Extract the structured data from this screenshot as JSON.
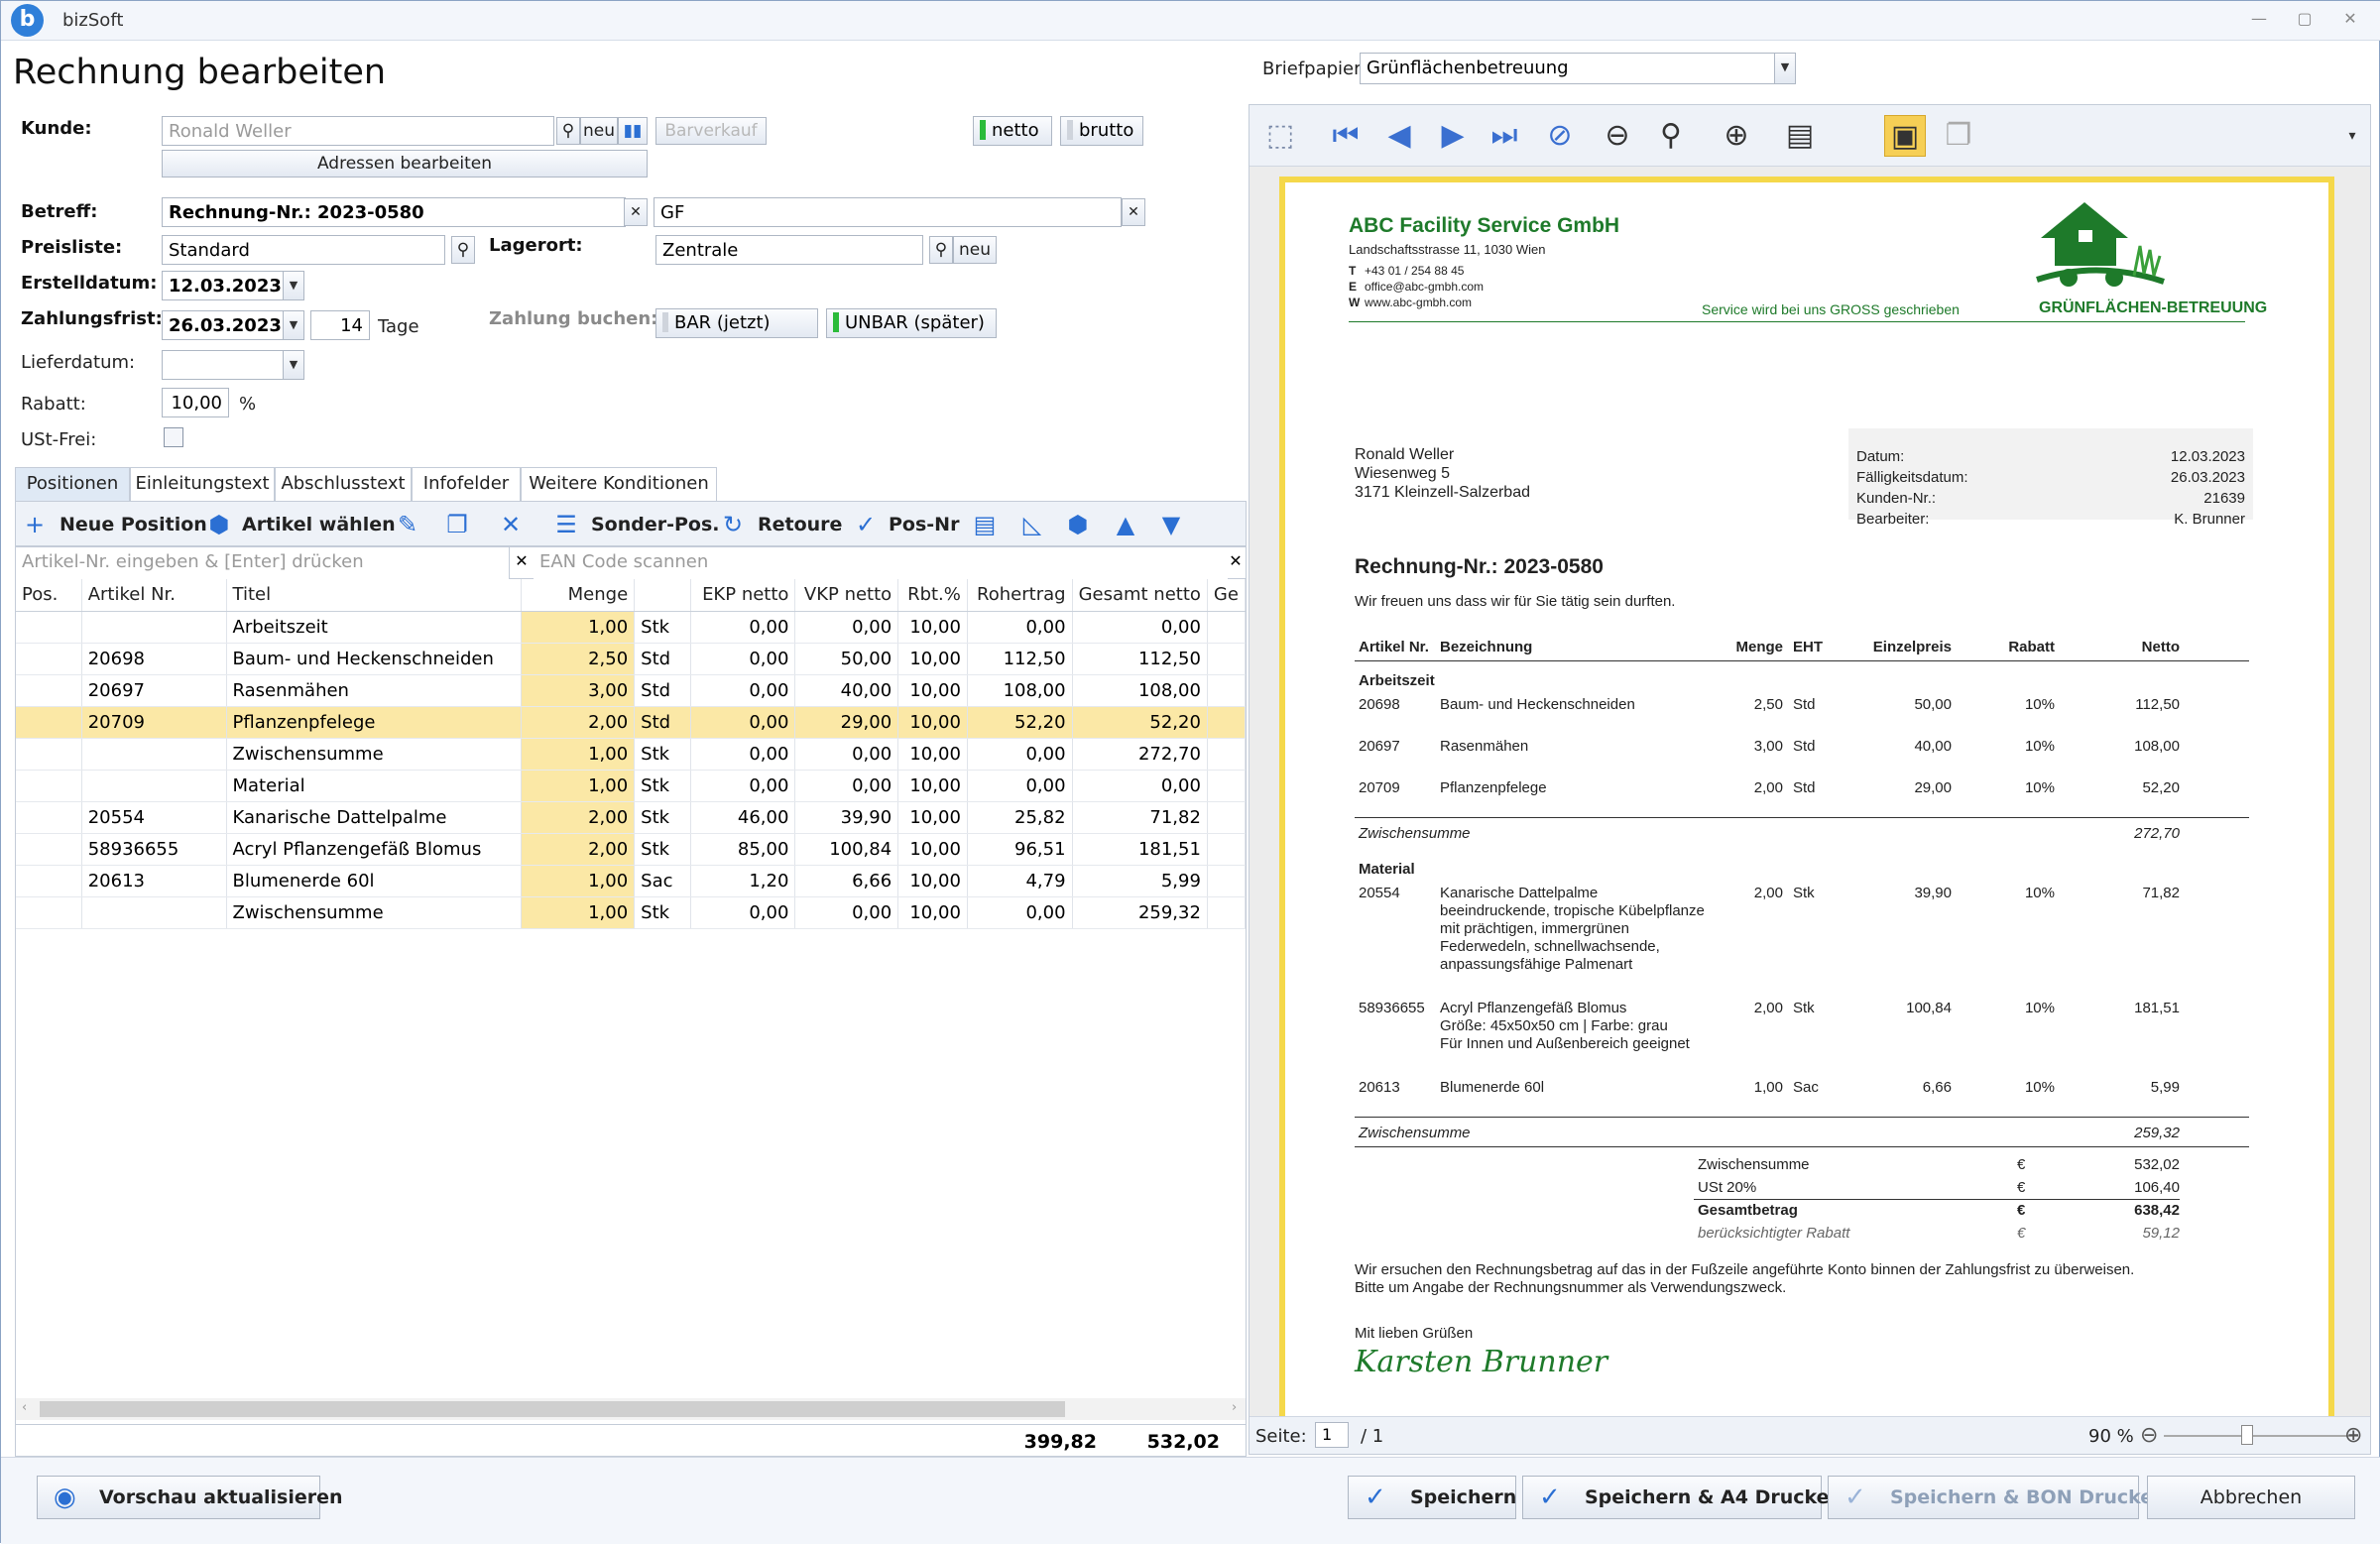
{
  "app": {
    "name": "bizSoft"
  },
  "header": {
    "title": "Rechnung bearbeiten"
  },
  "briefpapier": {
    "label": "Briefpapier:",
    "value": "Grünflächenbetreuung"
  },
  "form": {
    "kunde_label": "Kunde:",
    "kunde_value": "Ronald Weller",
    "neu_label": "neu",
    "barverkauf_label": "Barverkauf",
    "netto_label": "netto",
    "brutto_label": "brutto",
    "adressen_label": "Adressen bearbeiten",
    "betreff_label": "Betreff:",
    "betreff_value": "Rechnung-Nr.: 2023-0580",
    "betreff2_value": "GF",
    "preisliste_label": "Preisliste:",
    "preisliste_value": "Standard",
    "lagerort_label": "Lagerort:",
    "lagerort_value": "Zentrale",
    "lager_neu_label": "neu",
    "erstelldatum_label": "Erstelldatum:",
    "erstelldatum_value": "12.03.2023",
    "zahlungsfrist_label": "Zahlungsfrist:",
    "zahlungsfrist_value": "26.03.2023",
    "tage_value": "14",
    "tage_label": "Tage",
    "zahlung_buchen_label": "Zahlung buchen:",
    "bar_label": "BAR (jetzt)",
    "unbar_label": "UNBAR (später)",
    "lieferdatum_label": "Lieferdatum:",
    "rabatt_label": "Rabatt:",
    "rabatt_value": "10,00",
    "rabatt_unit": "%",
    "ustfrei_label": "USt-Frei:"
  },
  "tabs": [
    "Positionen",
    "Einleitungstext",
    "Abschlusstext",
    "Infofelder",
    "Weitere Konditionen"
  ],
  "toolbar": {
    "neue_position": "Neue Position",
    "artikel_waehlen": "Artikel wählen",
    "sonder_pos": "Sonder-Pos.",
    "retoure": "Retoure",
    "pos_nr": "Pos-Nr"
  },
  "search": {
    "artikel_placeholder": "Artikel-Nr. eingeben & [Enter] drücken",
    "ean_placeholder": "EAN Code scannen"
  },
  "grid": {
    "columns": [
      "Pos.",
      "Artikel Nr.",
      "Titel",
      "Menge",
      "",
      "EKP netto",
      "VKP netto",
      "Rbt.%",
      "Rohertrag",
      "Gesamt netto",
      "Ge"
    ],
    "rows": [
      {
        "pos": "",
        "nr": "",
        "titel": "Arbeitszeit",
        "menge": "1,00",
        "eh": "Stk",
        "ekp": "0,00",
        "vkp": "0,00",
        "rbt": "10,00",
        "roh": "0,00",
        "ges": "0,00"
      },
      {
        "pos": "",
        "nr": "20698",
        "titel": "Baum- und Heckenschneiden",
        "menge": "2,50",
        "eh": "Std",
        "ekp": "0,00",
        "vkp": "50,00",
        "rbt": "10,00",
        "roh": "112,50",
        "ges": "112,50"
      },
      {
        "pos": "",
        "nr": "20697",
        "titel": "Rasenmähen",
        "menge": "3,00",
        "eh": "Std",
        "ekp": "0,00",
        "vkp": "40,00",
        "rbt": "10,00",
        "roh": "108,00",
        "ges": "108,00"
      },
      {
        "pos": "",
        "nr": "20709",
        "titel": "Pflanzenpfelege",
        "menge": "2,00",
        "eh": "Std",
        "ekp": "0,00",
        "vkp": "29,00",
        "rbt": "10,00",
        "roh": "52,20",
        "ges": "52,20"
      },
      {
        "pos": "",
        "nr": "",
        "titel": "Zwischensumme",
        "menge": "1,00",
        "eh": "Stk",
        "ekp": "0,00",
        "vkp": "0,00",
        "rbt": "10,00",
        "roh": "0,00",
        "ges": "272,70"
      },
      {
        "pos": "",
        "nr": "",
        "titel": "Material",
        "menge": "1,00",
        "eh": "Stk",
        "ekp": "0,00",
        "vkp": "0,00",
        "rbt": "10,00",
        "roh": "0,00",
        "ges": "0,00"
      },
      {
        "pos": "",
        "nr": "20554",
        "titel": "Kanarische Dattelpalme",
        "menge": "2,00",
        "eh": "Stk",
        "ekp": "46,00",
        "vkp": "39,90",
        "rbt": "10,00",
        "roh": "25,82",
        "ges": "71,82"
      },
      {
        "pos": "",
        "nr": "58936655",
        "titel": "Acryl Pflanzengefäß Blomus",
        "menge": "2,00",
        "eh": "Stk",
        "ekp": "85,00",
        "vkp": "100,84",
        "rbt": "10,00",
        "roh": "96,51",
        "ges": "181,51"
      },
      {
        "pos": "",
        "nr": "20613",
        "titel": "Blumenerde 60l",
        "menge": "1,00",
        "eh": "Sac",
        "ekp": "1,20",
        "vkp": "6,66",
        "rbt": "10,00",
        "roh": "4,79",
        "ges": "5,99"
      },
      {
        "pos": "",
        "nr": "",
        "titel": "Zwischensumme",
        "menge": "1,00",
        "eh": "Stk",
        "ekp": "0,00",
        "vkp": "0,00",
        "rbt": "10,00",
        "roh": "0,00",
        "ges": "259,32"
      }
    ],
    "selected_row": 3,
    "sum_rohertrag": "399,82",
    "sum_gesamt": "532,02"
  },
  "preview": {
    "company": "ABC Facility Service GmbH",
    "address": "Landschaftsstrasse 11, 1030 Wien",
    "contact": [
      {
        "k": "T",
        "v": "+43 01 / 254 88 45"
      },
      {
        "k": "E",
        "v": "office@abc-gmbh.com"
      },
      {
        "k": "W",
        "v": "www.abc-gmbh.com"
      }
    ],
    "slogan": "Service wird bei uns GROSS geschrieben",
    "logo_text": "GRÜNFLÄCHEN-BETREUUNG",
    "recipient": [
      "Ronald Weller",
      "Wiesenweg 5",
      "3171 Kleinzell-Salzerbad"
    ],
    "meta": [
      {
        "k": "Datum:",
        "v": "12.03.2023"
      },
      {
        "k": "Fälligkeitsdatum:",
        "v": "26.03.2023"
      },
      {
        "k": "Kunden-Nr.:",
        "v": "21639"
      },
      {
        "k": "Bearbeiter:",
        "v": "K. Brunner"
      }
    ],
    "title": "Rechnung-Nr.: 2023-0580",
    "intro": "Wir freuen uns dass wir für Sie tätig sein durften.",
    "headers": [
      "Artikel Nr.",
      "Bezeichnung",
      "Menge",
      "EHT",
      "Einzelpreis",
      "Rabatt",
      "Netto"
    ],
    "group1": "Arbeitszeit",
    "items1": [
      {
        "nr": "20698",
        "bez": "Baum- und Heckenschneiden",
        "menge": "2,50",
        "eht": "Std",
        "preis": "50,00",
        "rabatt": "10%",
        "netto": "112,50"
      },
      {
        "nr": "20697",
        "bez": "Rasenmähen",
        "menge": "3,00",
        "eht": "Std",
        "preis": "40,00",
        "rabatt": "10%",
        "netto": "108,00"
      },
      {
        "nr": "20709",
        "bez": "Pflanzenpfelege",
        "menge": "2,00",
        "eht": "Std",
        "preis": "29,00",
        "rabatt": "10%",
        "netto": "52,20"
      }
    ],
    "zws1_label": "Zwischensumme",
    "zws1_value": "272,70",
    "group2": "Material",
    "items2": [
      {
        "nr": "20554",
        "bez": "Kanarische Dattelpalme",
        "menge": "2,00",
        "eht": "Stk",
        "preis": "39,90",
        "rabatt": "10%",
        "netto": "71,82",
        "desc": [
          "beeindruckende, tropische Kübelpflanze",
          "mit prächtigen, immergrünen",
          "Federwedeln, schnellwachsende,",
          "anpassungsfähige Palmenart"
        ]
      },
      {
        "nr": "58936655",
        "bez": "Acryl Pflanzengefäß Blomus",
        "menge": "2,00",
        "eht": "Stk",
        "preis": "100,84",
        "rabatt": "10%",
        "netto": "181,51",
        "desc": [
          "Größe: 45x50x50 cm | Farbe: grau",
          "Für Innen und Außenbereich geeignet"
        ]
      },
      {
        "nr": "20613",
        "bez": "Blumenerde 60l",
        "menge": "1,00",
        "eht": "Sac",
        "preis": "6,66",
        "rabatt": "10%",
        "netto": "5,99"
      }
    ],
    "zws2_label": "Zwischensumme",
    "zws2_value": "259,32",
    "totals": [
      {
        "k": "Zwischensumme",
        "c": "€",
        "v": "532,02"
      },
      {
        "k": "USt 20%",
        "c": "€",
        "v": "106,40"
      },
      {
        "k": "Gesamtbetrag",
        "c": "€",
        "v": "638,42"
      },
      {
        "k": "berücksichtigter Rabatt",
        "c": "€",
        "v": "59,12"
      }
    ],
    "footer1": "Wir ersuchen den Rechnungsbetrag auf das in der Fußzeile angeführte Konto binnen der Zahlungsfrist zu überweisen.",
    "footer2": "Bitte um Angabe der Rechnungsnummer als Verwendungszweck.",
    "greeting": "Mit lieben Grüßen",
    "signature": "Karsten Brunner",
    "status": {
      "seite_label": "Seite:",
      "seite": "1",
      "of": "/ 1",
      "zoom": "90 %"
    }
  },
  "buttons": {
    "vorschau": "Vorschau aktualisieren",
    "speichern": "Speichern",
    "speichern_a4": "Speichern & A4 Drucken",
    "speichern_bon": "Speichern & BON Drucken",
    "abbrechen": "Abbrechen"
  },
  "colors": {
    "accent": "#2b6fd3",
    "highlight": "#fbe8a6",
    "green": "#1e7a2a",
    "paper_border": "#f5d84a"
  }
}
